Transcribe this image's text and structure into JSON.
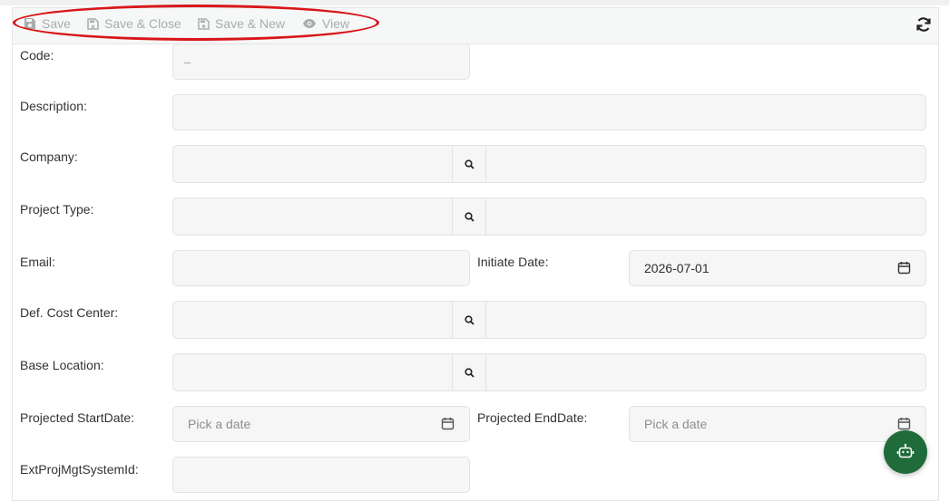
{
  "toolbar": {
    "save_label": "Save",
    "save_close_label": "Save & Close",
    "save_new_label": "Save & New",
    "view_label": "View"
  },
  "form": {
    "code": {
      "label": "Code:",
      "value": "–"
    },
    "description": {
      "label": "Description:"
    },
    "company": {
      "label": "Company:"
    },
    "project_type": {
      "label": "Project Type:"
    },
    "email": {
      "label": "Email:"
    },
    "initiate_date": {
      "label": "Initiate Date:",
      "value": "2026-07-01"
    },
    "def_cost_center": {
      "label": "Def. Cost Center:"
    },
    "base_location": {
      "label": "Base Location:"
    },
    "projected_start": {
      "label": "Projected StartDate:",
      "placeholder": "Pick a date"
    },
    "projected_end": {
      "label": "Projected EndDate:",
      "placeholder": "Pick a date"
    },
    "ext_proj": {
      "label": "ExtProjMgtSystemId:"
    }
  },
  "colors": {
    "annotation": "#d8161a",
    "fab": "#1f6b3a",
    "toolbar_disabled": "#a9adad"
  }
}
